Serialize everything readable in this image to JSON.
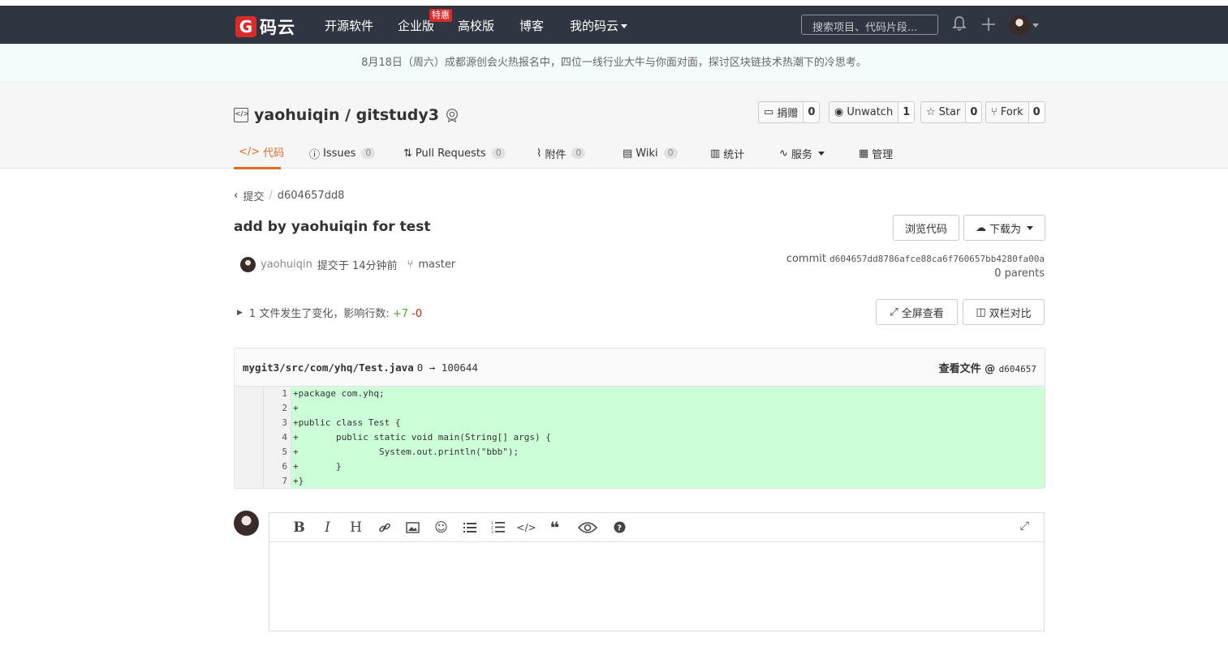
{
  "nav": {
    "brand": "码云",
    "items": [
      "开源软件",
      "企业版",
      "高校版",
      "博客",
      "我的码云"
    ],
    "hot_badge": "特惠",
    "search_placeholder": "搜索项目、代码片段..."
  },
  "announcement": "8月18日（周六）成都源创会火热报名中，四位一线行业大牛与你面对面，探讨区块链技术热潮下的冷思考。",
  "repo": {
    "title": "yaohuiqin / gitstudy3",
    "actions": [
      {
        "label": "捐赠",
        "count": "0"
      },
      {
        "label": "Unwatch",
        "count": "1"
      },
      {
        "label": "Star",
        "count": "0"
      },
      {
        "label": "Fork",
        "count": "0"
      }
    ],
    "tabs": [
      {
        "label": "代码",
        "count": ""
      },
      {
        "label": "Issues",
        "count": "0"
      },
      {
        "label": "Pull Requests",
        "count": "0"
      },
      {
        "label": "附件",
        "count": "0"
      },
      {
        "label": "Wiki",
        "count": "0"
      },
      {
        "label": "统计",
        "count": ""
      },
      {
        "label": "服务",
        "count": ""
      },
      {
        "label": "管理",
        "count": ""
      }
    ]
  },
  "commit": {
    "crumb_parent": "提交",
    "crumb_current": "d604657dd8",
    "title": "add by yaohuiqin for test",
    "browse_label": "浏览代码",
    "download_label": "下载为",
    "author": "yaohuiqin",
    "time_text": "提交于 14分钟前",
    "branch": "master",
    "commit_label": "commit",
    "sha": "d604657dd8786afce88ca6f760657bb4280fa00a",
    "parents": "0 parents",
    "stats_text": "1 文件发生了变化，影响行数:",
    "additions": "+7",
    "deletions": "-0",
    "fullscreen_label": "全屏查看",
    "split_label": "双栏对比"
  },
  "diff": {
    "path": "mygit3/src/com/yhq/Test.java",
    "mode_change": "0 → 100644",
    "view_file_label": "查看文件 @",
    "short_sha": "d604657",
    "lines": [
      {
        "num": "1",
        "code": "+package com.yhq;"
      },
      {
        "num": "2",
        "code": "+"
      },
      {
        "num": "3",
        "code": "+public class Test {"
      },
      {
        "num": "4",
        "code": "+       public static void main(String[] args) {"
      },
      {
        "num": "5",
        "code": "+               System.out.println(\"bbb\");"
      },
      {
        "num": "6",
        "code": "+       }"
      },
      {
        "num": "7",
        "code": "+}"
      }
    ]
  },
  "colors": {
    "navbar": "#2f3541",
    "accent": "#e26b2b",
    "added_bg": "#ccffd8",
    "brand_red": "#d82c2c"
  }
}
